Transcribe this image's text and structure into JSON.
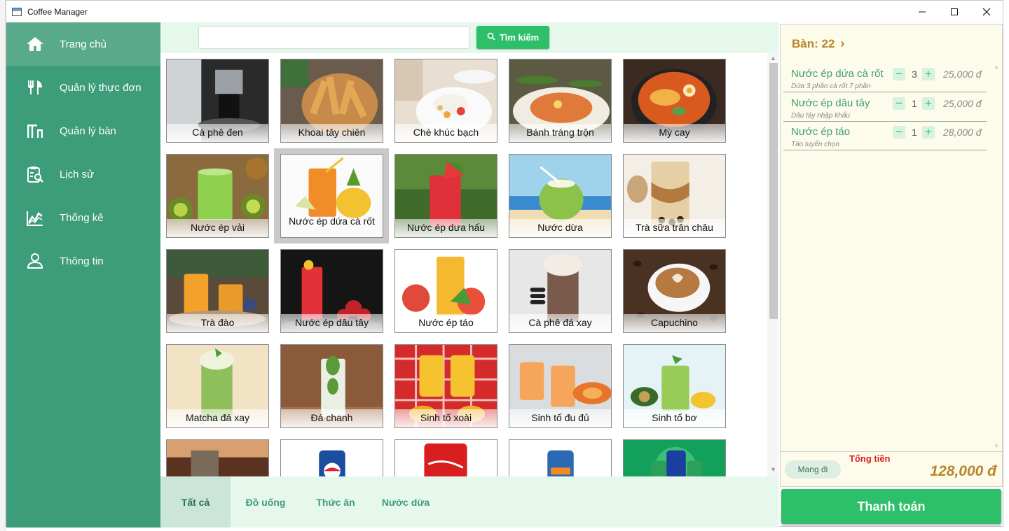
{
  "window": {
    "title": "Coffee Manager"
  },
  "sidebar": {
    "items": [
      {
        "label": "Trang chủ",
        "icon": "home-icon",
        "active": true
      },
      {
        "label": "Quản lý thực đơn",
        "icon": "fork-knife-icon",
        "active": false
      },
      {
        "label": "Quản lý bàn",
        "icon": "table-icon",
        "active": false
      },
      {
        "label": "Lịch sử",
        "icon": "history-icon",
        "active": false
      },
      {
        "label": "Thống kê",
        "icon": "stats-icon",
        "active": false
      },
      {
        "label": "Thông tin",
        "icon": "user-icon",
        "active": false
      }
    ]
  },
  "search": {
    "value": "",
    "button_label": "Tìm kiếm"
  },
  "products": [
    {
      "name": "Cà phê đen"
    },
    {
      "name": "Khoai tây chiên"
    },
    {
      "name": "Chè khúc bạch"
    },
    {
      "name": "Bánh tráng trộn"
    },
    {
      "name": "Mỳ cay"
    },
    {
      "name": "Nước ép vải"
    },
    {
      "name": "Nước ép dứa cà rốt"
    },
    {
      "name": "Nước ép dưa hấu"
    },
    {
      "name": "Nước dừa"
    },
    {
      "name": "Trà sữa trân châu"
    },
    {
      "name": "Trà đào"
    },
    {
      "name": "Nước ép dâu tây"
    },
    {
      "name": "Nước ép táo"
    },
    {
      "name": "Cà phê đá xay"
    },
    {
      "name": "Capuchino"
    },
    {
      "name": "Matcha đá xay"
    },
    {
      "name": "Đá chanh"
    },
    {
      "name": "Sinh tố xoài"
    },
    {
      "name": "Sinh tố đu đủ"
    },
    {
      "name": "Sinh tố bơ"
    },
    {
      "name": ""
    },
    {
      "name": ""
    },
    {
      "name": ""
    },
    {
      "name": ""
    },
    {
      "name": ""
    }
  ],
  "tabs": [
    {
      "label": "Tất cả",
      "active": true
    },
    {
      "label": "Đồ uống",
      "active": false
    },
    {
      "label": "Thức ăn",
      "active": false
    },
    {
      "label": "Nước dừa",
      "active": false
    }
  ],
  "order": {
    "table_label": "Bàn: 22",
    "items": [
      {
        "name": "Nước ép dứa cà rốt",
        "note": "Dứa 3 phần cà rốt 7 phần",
        "qty": "3",
        "price": "25,000 đ"
      },
      {
        "name": "Nước ép dâu tây",
        "note": "Dâu tây nhập khẩu",
        "qty": "1",
        "price": "25,000 đ"
      },
      {
        "name": "Nước ép táo",
        "note": "Táo tuyển chọn",
        "qty": "1",
        "price": "28,000 đ"
      }
    ],
    "takeaway_label": "Mang đi",
    "total_label": "Tổng tiền",
    "total_value": "128,000 đ",
    "pay_label": "Thanh toán"
  },
  "colors": {
    "sidebar": "#3d9c79",
    "accent": "#2ebf6a",
    "panel_bg": "#fdfbe9",
    "gold": "#b8862a",
    "total_red": "#e02020"
  }
}
